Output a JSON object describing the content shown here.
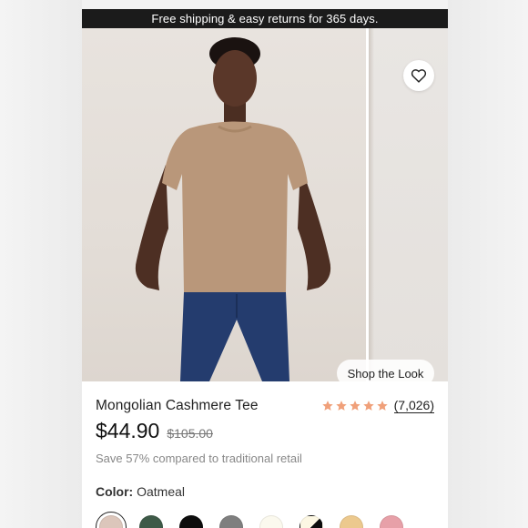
{
  "promo": {
    "text": "Free shipping & easy returns for 365 days."
  },
  "gallery": {
    "shop_the_look_label": "Shop the Look",
    "favorite_icon": "heart-outline-icon"
  },
  "product": {
    "name": "Mongolian Cashmere Tee",
    "rating": 5,
    "review_count": "(7,026)",
    "price": "$44.90",
    "original_price": "$105.00",
    "savings_text": "Save 57% compared to traditional retail"
  },
  "color": {
    "label": "Color:",
    "selected_value": "Oatmeal",
    "swatches": [
      {
        "name": "oatmeal",
        "color": "#dcc6bb",
        "selected": true
      },
      {
        "name": "green",
        "color": "#3e5a48"
      },
      {
        "name": "black",
        "color": "#0d0d0d"
      },
      {
        "name": "gray",
        "color": "#7f7f7f"
      },
      {
        "name": "ivory",
        "color": "#fbf9ee"
      },
      {
        "name": "ivory-black",
        "color": "#fcf7e3",
        "color2": "#0d0d0d"
      },
      {
        "name": "tan",
        "color": "#ecc98e"
      },
      {
        "name": "pink",
        "color": "#e7a0a8"
      }
    ]
  },
  "colors": {
    "star": "#f0a07a",
    "promo_bg": "#1b1b1b",
    "text": "#222222"
  }
}
